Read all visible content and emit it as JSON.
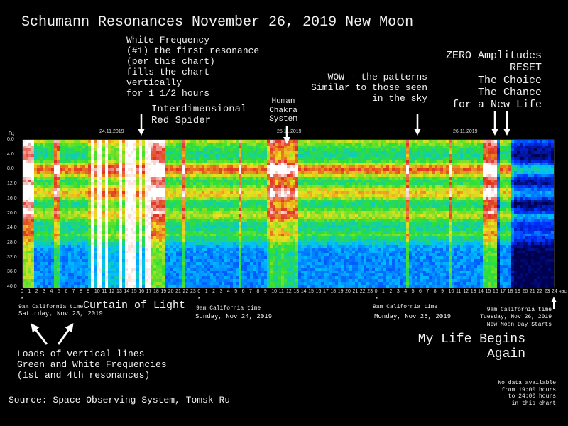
{
  "title": "Schumann Resonances November 26, 2019 New Moon",
  "annotations": {
    "white_frequency": "White Frequency\n(#1) the first resonance\n(per this chart)\nfills the chart\nvertically\nfor 1 1/2 hours",
    "red_spider": "Interdimensional\nRed Spider",
    "chakra": "Human\nChakra\nSystem",
    "wow": "WOW - the patterns\nSimilar to those seen\nin the sky",
    "zero": "ZERO Amplitudes\nRESET\nThe Choice\nThe Chance\nfor a New Life",
    "curtain": "Curtain of Light",
    "sat_time": "9am California time",
    "sat_date": "Saturday, Nov 23, 2019",
    "sun_time": "9am California time",
    "sun_date": "Sunday, Nov 24, 2019",
    "mon_time": "9am California time",
    "mon_date": "Monday, Nov 25, 2019",
    "tue": "9am California time\nTuesday, Nov 26, 2019\nNew Moon Day Starts",
    "vertical_lines": "Loads of vertical lines\nGreen and White Frequencies\n(1st and 4th resonances)",
    "life": "My Life Begins\nAgain",
    "source": "Source: Space Observing System, Tomsk Ru",
    "no_data": "No data available\nfrom 19:00 hours\nto 24:00 hours\nin this chart",
    "star": "*"
  },
  "chart_data": {
    "type": "heatmap",
    "ylabel": "Гц",
    "xlabel": "час",
    "ylim": [
      0,
      40
    ],
    "xlim_hours": [
      0,
      72
    ],
    "y_ticks": [
      "0.0",
      "4.0",
      "8.0",
      "12.0",
      "16.0",
      "20.0",
      "24.0",
      "28.0",
      "32.0",
      "36.0",
      "40.0"
    ],
    "x_ticks": [
      "0",
      "1",
      "2",
      "3",
      "4",
      "5",
      "6",
      "7",
      "8",
      "9",
      "10",
      "11",
      "12",
      "13",
      "14",
      "15",
      "16",
      "17",
      "18",
      "19",
      "20",
      "21",
      "22",
      "23",
      "0",
      "1",
      "2",
      "3",
      "4",
      "5",
      "6",
      "7",
      "8",
      "9",
      "10",
      "11",
      "12",
      "13",
      "14",
      "15",
      "16",
      "17",
      "18",
      "19",
      "20",
      "21",
      "22",
      "23",
      "0",
      "1",
      "2",
      "3",
      "4",
      "5",
      "6",
      "7",
      "8",
      "9",
      "10",
      "11",
      "12",
      "13",
      "14",
      "15",
      "16",
      "17",
      "18",
      "19",
      "20",
      "21",
      "22",
      "23",
      "24"
    ],
    "date_labels": [
      "24.11.2019",
      "25.11.2019",
      "26.11.2019"
    ],
    "resonance_bands_hz": [
      7.8,
      14,
      20,
      26
    ],
    "colorscale": [
      "#000050",
      "#0030ff",
      "#00c0ff",
      "#30e030",
      "#f0e020",
      "#e03020",
      "#ffffff"
    ]
  }
}
